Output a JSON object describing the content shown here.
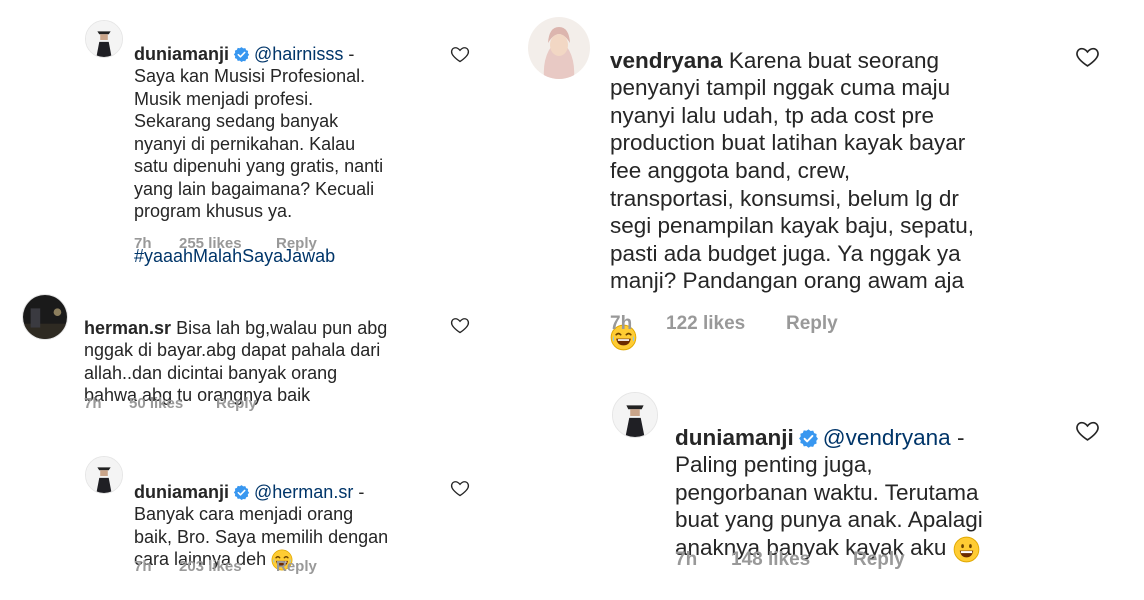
{
  "comments": [
    {
      "username": "duniamanji",
      "verified": true,
      "mention": "@hairnisss",
      "text": "-\nSaya kan Musisi Profesional.\nMusik menjadi profesi.\nSekarang sedang banyak\nnyanyi di pernikahan. Kalau\nsatu dipenuhi yang gratis, nanti\nyang lain bagaimana? Kecuali\nprogram khusus ya.",
      "hashtag": "#yaaahMalahSayaJawab",
      "time": "7h",
      "likes": "255 likes",
      "reply": "Reply"
    },
    {
      "username": "herman.sr",
      "verified": false,
      "text": "Bisa lah bg,walau pun abg\nnggak di bayar.abg dapat pahala dari\nallah..dan dicintai banyak orang\nbahwa abg tu orangnya baik",
      "time": "7h",
      "likes": "50 likes",
      "reply": "Reply"
    },
    {
      "username": "duniamanji",
      "verified": true,
      "mention": "@herman.sr",
      "text": "-\nBanyak cara menjadi orang\nbaik, Bro. Saya memilih dengan\ncara lainnya deh",
      "time": "7h",
      "likes": "203 likes",
      "reply": "Reply"
    },
    {
      "username": "vendryana",
      "verified": false,
      "text": "Karena buat seorang\npenyanyi tampil nggak cuma maju\nnyanyi lalu udah, tp ada cost pre\nproduction buat latihan kayak bayar\nfee anggota band, crew,\ntransportasi, konsumsi, belum lg dr\nsegi penampilan kayak baju, sepatu,\npasti ada budget juga. Ya nggak ya\nmanji? Pandangan orang awam aja",
      "time": "7h",
      "likes": "122 likes",
      "reply": "Reply"
    },
    {
      "username": "duniamanji",
      "verified": true,
      "mention": "@vendryana",
      "text": "-\nPaling penting juga,\npengorbanan waktu. Terutama\nbuat yang punya anak. Apalagi\nanaknya banyak kayak aku",
      "time": "7h",
      "likes": "148 likes",
      "reply": "Reply"
    }
  ],
  "icons": {
    "heart": "heart-outline-icon",
    "verified": "verified-badge-icon"
  },
  "colors": {
    "username": "#262626",
    "mention": "#003569",
    "meta": "#999999",
    "verified": "#3897f0"
  }
}
